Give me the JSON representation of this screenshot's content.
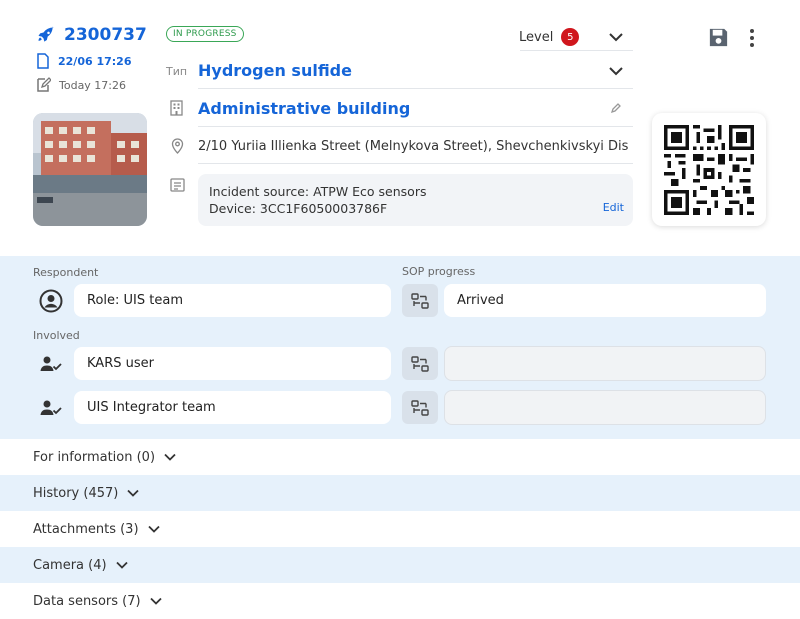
{
  "incident": {
    "id": "2300737",
    "created": "22/06 17:26",
    "updated": "Today 17:26",
    "status": "IN PROGRESS"
  },
  "level": {
    "label": "Level",
    "value": "5"
  },
  "details": {
    "type_label": "Тип",
    "type": "Hydrogen sulfide",
    "object": "Administrative building",
    "address": "2/10 Yuriia Illienka Street (Melnykova Street), Shevchenkivskyi Dis...",
    "note_line1": "Incident source: ATPW Eco sensors",
    "note_line2": "Device: 3CC1F6050003786F",
    "edit_label": "Edit"
  },
  "people": {
    "respondent_label": "Respondent",
    "sop_label": "SOP progress",
    "involved_label": "Involved",
    "respondent": "Role: UIS team",
    "sop_status": "Arrived",
    "involved": [
      "KARS user",
      "UIS Integrator team"
    ]
  },
  "sections": [
    {
      "label": "For information (0)"
    },
    {
      "label": "History (457)"
    },
    {
      "label": "Attachments (3)"
    },
    {
      "label": "Camera (4)"
    },
    {
      "label": "Data sensors (7)"
    }
  ],
  "colors": {
    "accent": "#1565d8",
    "status_green": "#2e9a4c",
    "level_red": "#d0161d",
    "panel_bg": "#e6f1fb"
  }
}
